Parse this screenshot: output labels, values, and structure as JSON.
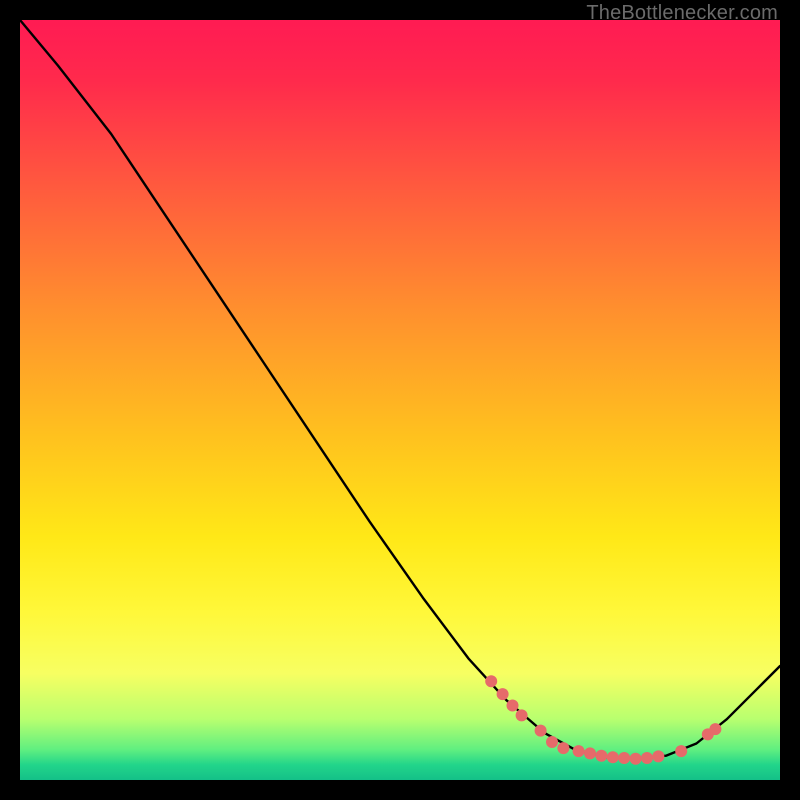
{
  "watermark": "TheBottlenecker.com",
  "chart_data": {
    "type": "line",
    "title": "",
    "xlabel": "",
    "ylabel": "",
    "xlim": [
      0,
      100
    ],
    "ylim": [
      0,
      100
    ],
    "grid": false,
    "note": "Axes/ticks not rendered in screenshot; values below are fractional estimates of the single black curve in the 760×760 plotting area (origin at top-left, y increases downward).",
    "series": [
      {
        "name": "curve",
        "color": "#000000",
        "points_xy_fraction": [
          [
            0.0,
            0.0
          ],
          [
            0.05,
            0.06
          ],
          [
            0.12,
            0.15
          ],
          [
            0.18,
            0.24
          ],
          [
            0.25,
            0.345
          ],
          [
            0.32,
            0.45
          ],
          [
            0.39,
            0.555
          ],
          [
            0.46,
            0.66
          ],
          [
            0.53,
            0.76
          ],
          [
            0.59,
            0.84
          ],
          [
            0.64,
            0.895
          ],
          [
            0.69,
            0.938
          ],
          [
            0.73,
            0.96
          ],
          [
            0.77,
            0.97
          ],
          [
            0.81,
            0.972
          ],
          [
            0.85,
            0.968
          ],
          [
            0.89,
            0.952
          ],
          [
            0.93,
            0.92
          ],
          [
            0.97,
            0.88
          ],
          [
            1.0,
            0.85
          ]
        ]
      }
    ],
    "markers": {
      "name": "dots",
      "color": "#e66a6a",
      "radius_px": 6,
      "points_xy_fraction": [
        [
          0.62,
          0.87
        ],
        [
          0.635,
          0.887
        ],
        [
          0.648,
          0.902
        ],
        [
          0.66,
          0.915
        ],
        [
          0.685,
          0.935
        ],
        [
          0.7,
          0.95
        ],
        [
          0.715,
          0.958
        ],
        [
          0.735,
          0.962
        ],
        [
          0.75,
          0.965
        ],
        [
          0.765,
          0.968
        ],
        [
          0.78,
          0.97
        ],
        [
          0.795,
          0.971
        ],
        [
          0.81,
          0.972
        ],
        [
          0.825,
          0.971
        ],
        [
          0.84,
          0.969
        ],
        [
          0.87,
          0.962
        ],
        [
          0.905,
          0.94
        ],
        [
          0.915,
          0.933
        ]
      ]
    }
  }
}
